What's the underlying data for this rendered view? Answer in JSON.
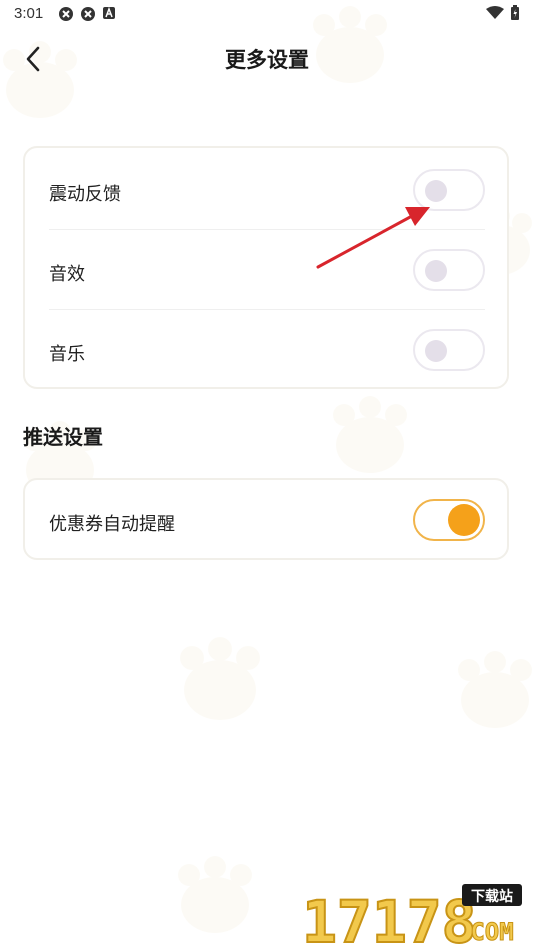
{
  "status_bar": {
    "time": "3:01"
  },
  "header": {
    "title": "更多设置"
  },
  "settings_card": {
    "rows": [
      {
        "label": "震动反馈",
        "enabled": false
      },
      {
        "label": "音效",
        "enabled": false
      },
      {
        "label": "音乐",
        "enabled": false
      }
    ]
  },
  "push_section": {
    "title": "推送设置",
    "rows": [
      {
        "label": "优惠券自动提醒",
        "enabled": true
      }
    ]
  },
  "watermark": {
    "number": "17178",
    "badge": "下载站",
    "suffix": "COM"
  },
  "colors": {
    "accent": "#f5a11a",
    "annotation_arrow": "#d8252c"
  }
}
